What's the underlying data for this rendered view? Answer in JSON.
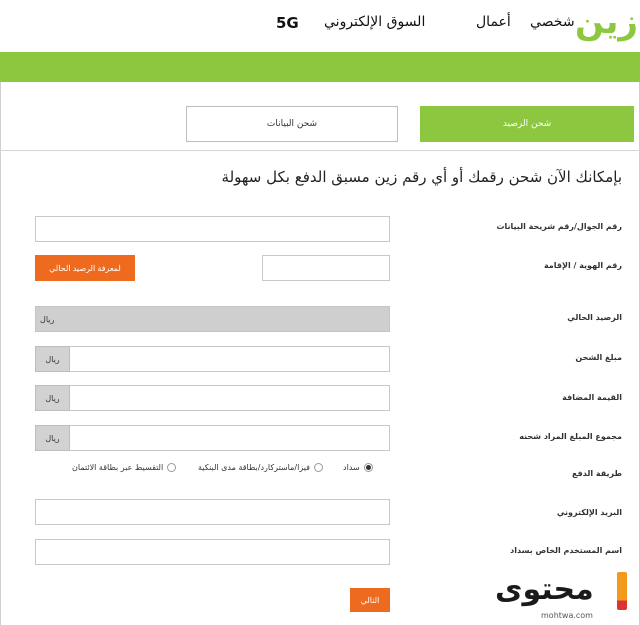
{
  "header": {
    "logo_text": "زين",
    "nav": [
      "شخصي",
      "أعمال",
      "السوق الإلكتروني",
      "5G"
    ]
  },
  "colors": {
    "brand_green": "#8dc63f",
    "accent_orange": "#ee6a1f",
    "unit_grey": "#d2d2d2"
  },
  "tabs": {
    "active": "شحن الرصيد",
    "other": "شحن البيانات"
  },
  "heading": "بإمكانك الآن شحن رقمك أو أي رقم زين مسبق الدفع بكل سهولة",
  "form": {
    "mobile_label": "رقم الجوال/رقم شريحة البيانات",
    "mobile_value": "",
    "id_label": "رقم الهوية / الإقامة",
    "id_value": "",
    "balance_button": "لمعرفة الرصيد الحالي",
    "current_balance_label": "الرصيد الحالي",
    "current_balance_unit": "ريال",
    "amount_label": "مبلغ الشحن",
    "amount_unit": "ريال",
    "vat_label": "القيمة المضافة",
    "vat_unit": "ريال",
    "total_label": "مجموع المبلغ المراد شحنه",
    "total_unit": "ريال",
    "payment_label": "طريقة الدفع",
    "payment_options": [
      "سداد",
      "فيزا/ماستركارد/بطاقة مدى البنكية",
      "التقسيط عبر بطاقة الائتمان"
    ],
    "payment_selected": "سداد",
    "email_label": "البريد الإلكتروني",
    "email_value": "",
    "sadad_user_label": "اسم المستخدم الخاص بسداد",
    "sadad_user_value": "",
    "next_button": "التالي"
  },
  "watermark": {
    "text": "محتوى",
    "sub": "mohtwa.com"
  }
}
